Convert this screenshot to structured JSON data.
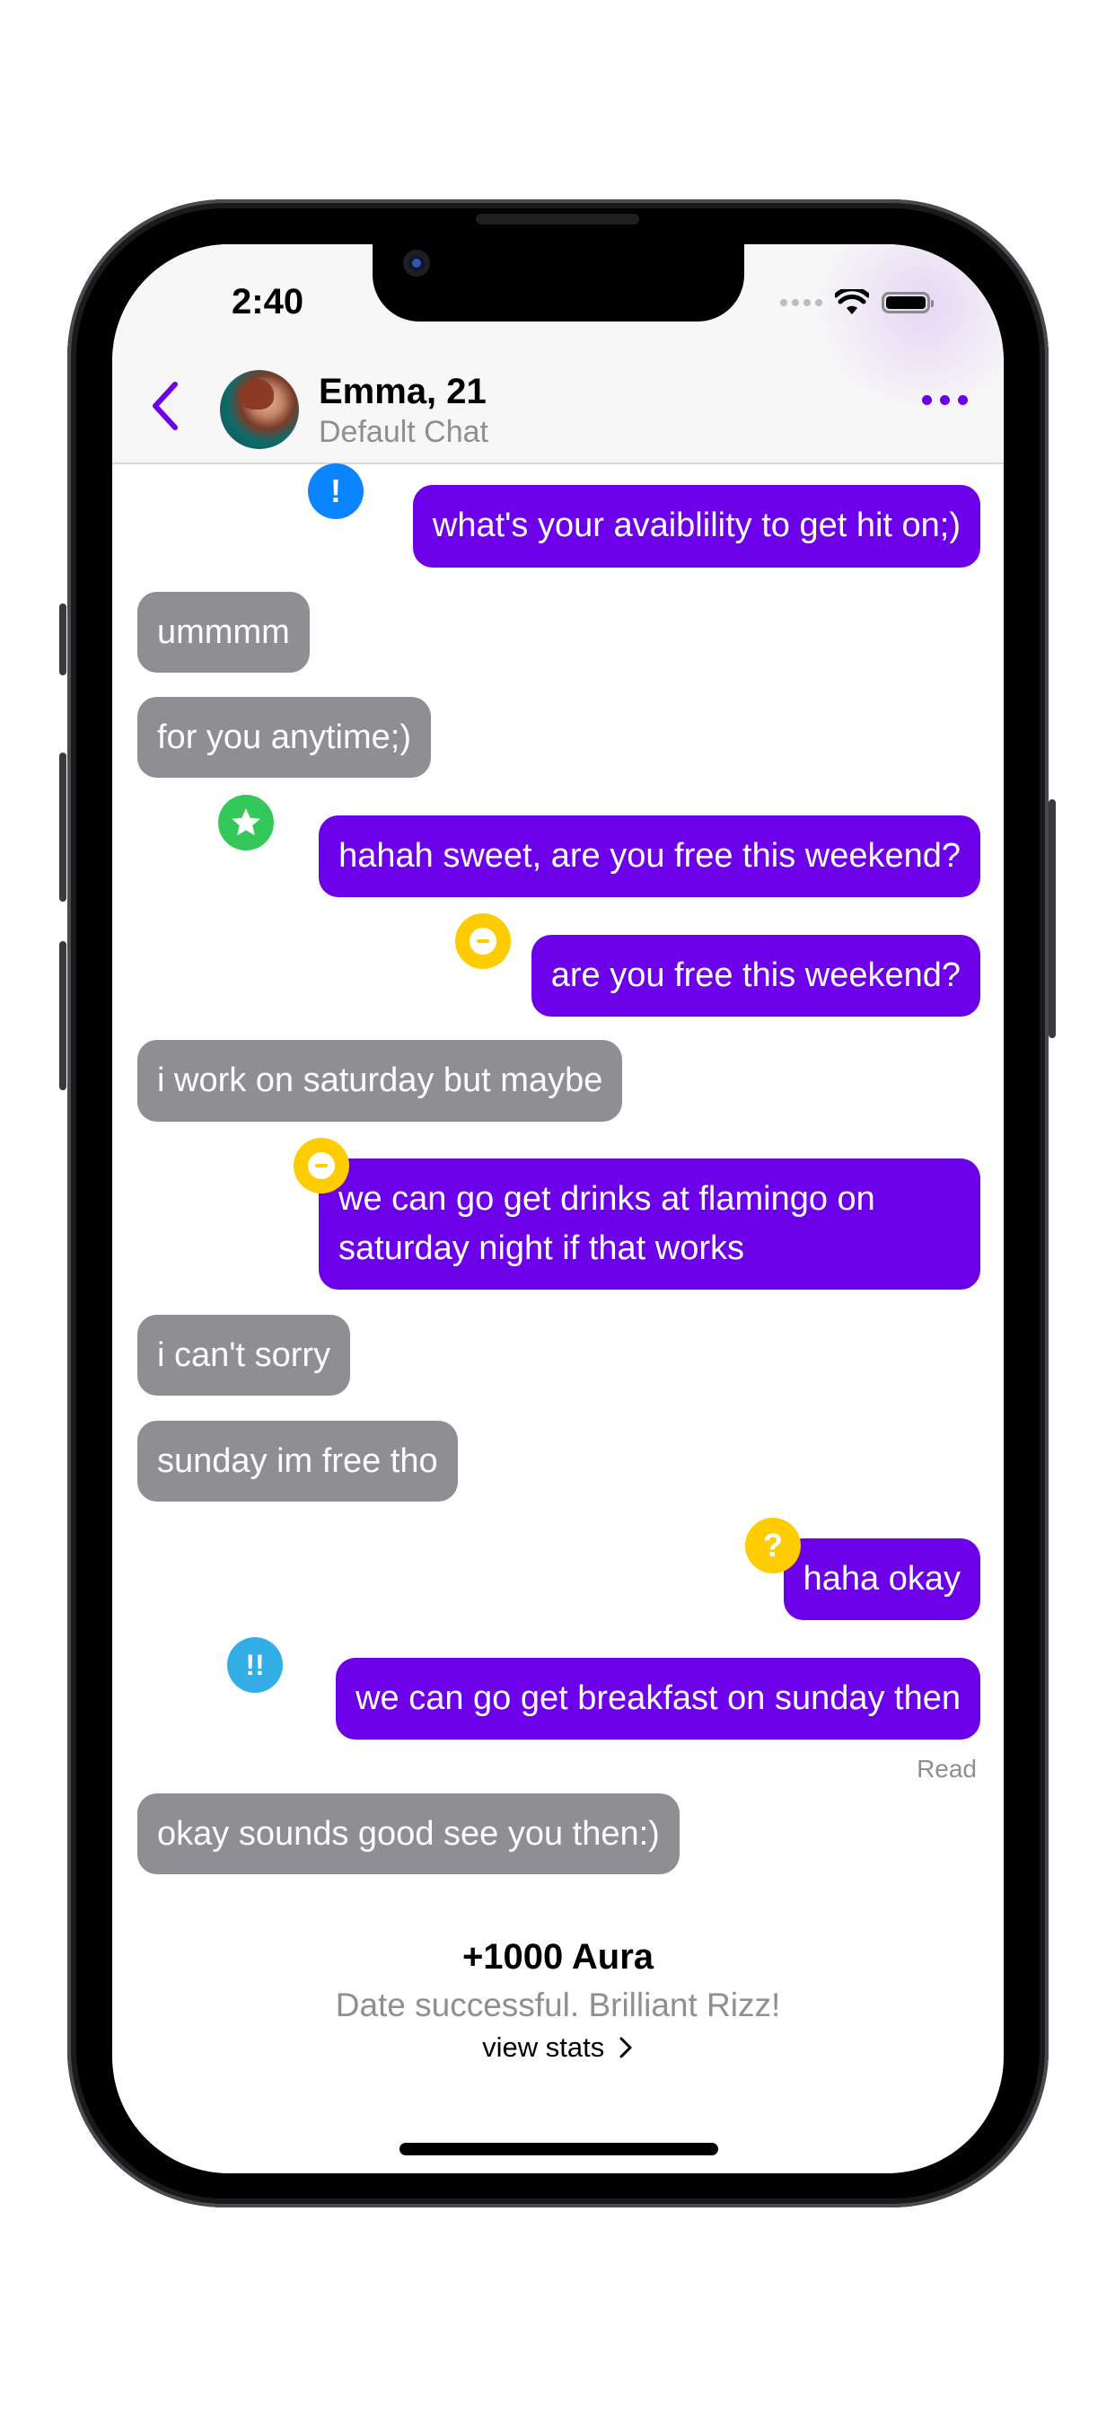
{
  "status_bar": {
    "time": "2:40",
    "icons": [
      "signal-icon",
      "wifi-icon",
      "battery-icon"
    ]
  },
  "header": {
    "back_icon": "chevron-left-icon",
    "contact_name": "Emma, 21",
    "subtitle": "Default Chat",
    "more_icon": "ellipsis-icon"
  },
  "colors": {
    "outgoing": "#6c00e8",
    "incoming": "#8e8e93",
    "accent": "#6c00e8"
  },
  "messages": [
    {
      "side": "out",
      "text": "what's your avaiblility to get hit on;)",
      "badge": {
        "type": "mistake",
        "glyph": "!",
        "color": "#0a84ff"
      }
    },
    {
      "side": "in",
      "text": "ummmm"
    },
    {
      "side": "in",
      "text": "for you anytime;)"
    },
    {
      "side": "out",
      "text": "hahah sweet, are you free this weekend?",
      "badge": {
        "type": "best",
        "glyph": "★",
        "color": "#34c759"
      }
    },
    {
      "side": "out",
      "text": "are you free this weekend?",
      "badge": {
        "type": "inaccuracy",
        "glyph": "−",
        "color": "#ffcc00"
      }
    },
    {
      "side": "in",
      "text": "i work on saturday but maybe"
    },
    {
      "side": "out",
      "text": "we can go get drinks at flamingo on saturday night if that works",
      "line1": "we can go get drinks at flamingo on",
      "line2": "saturday night if that works",
      "badge": {
        "type": "inaccuracy",
        "glyph": "−",
        "color": "#ffcc00"
      }
    },
    {
      "side": "in",
      "text": "i can't sorry"
    },
    {
      "side": "in",
      "text": "sunday im free tho"
    },
    {
      "side": "out",
      "text": "haha okay",
      "badge": {
        "type": "dubious",
        "glyph": "?",
        "color": "#ffcc00"
      }
    },
    {
      "side": "out",
      "text": "we can go get breakfast on sunday then",
      "badge": {
        "type": "brilliant",
        "glyph": "!!",
        "color": "#32ade6"
      }
    },
    {
      "side": "in",
      "text": "okay sounds good see you then:)"
    }
  ],
  "read_receipt": "Read",
  "result": {
    "title": "+1000 Aura",
    "subtitle": "Date successful. Brilliant Rizz!",
    "link": "view stats",
    "link_icon": "chevron-right-icon"
  }
}
